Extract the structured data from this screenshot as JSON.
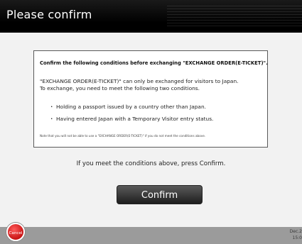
{
  "header": {
    "title": "Please confirm"
  },
  "dialog": {
    "heading": "Confirm the following conditions before exchanging \"EXCHANGE ORDER(E-TICKET)\".",
    "intro_lines": [
      "\"EXCHANGE ORDER(E-TICKET)\" can only be exchanged for visitors to Japan.",
      "To exchange, you need to meet the following two conditions."
    ],
    "conditions": [
      "Holding a passport issued by a country other than Japan.",
      "Having entered Japan with a Temporary Visitor entry status."
    ],
    "note": "Note that you will not be able to use a \"EXCHANGE ORDER(E-TICKET)\" if you do not meet the conditions above."
  },
  "prompt": "If you meet the conditions above, press Confirm.",
  "confirm_label": "Confirm",
  "cancel_label": "Cancel",
  "footer": {
    "date": "Dec.2",
    "time": "15:0"
  },
  "colors": {
    "header_bg": "#000000",
    "confirm_bg": "#333333",
    "cancel_bg": "#d11a1a",
    "footer_bg": "#9b9b9b"
  }
}
